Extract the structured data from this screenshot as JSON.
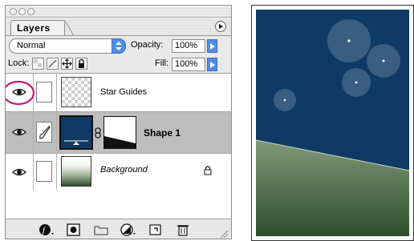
{
  "palette": {
    "tab_label": "Layers",
    "blend_mode": "Normal",
    "opacity_label": "Opacity:",
    "opacity_value": "100%",
    "lock_label": "Lock:",
    "fill_label": "Fill:",
    "fill_value": "100%"
  },
  "layers": [
    {
      "name": "Star Guides",
      "visible": true,
      "highlighted_eye": true
    },
    {
      "name": "Shape 1",
      "visible": true,
      "selected": true,
      "has_mask": true
    },
    {
      "name": "Background",
      "visible": true,
      "italic": true,
      "locked": true
    }
  ],
  "bottom_toolbar": {
    "icons": [
      "layer-style-icon",
      "mask-icon",
      "folder-icon",
      "adjustment-layer-icon",
      "new-layer-icon",
      "trash-icon"
    ]
  },
  "colors": {
    "selected_row": "#bdbdbd",
    "highlight_circle": "#c2187a",
    "sky": "#0f3a66",
    "ground_top": "#7f9a78",
    "ground_bottom": "#2d4d2a",
    "accent_blue": "#4f8ce3"
  }
}
